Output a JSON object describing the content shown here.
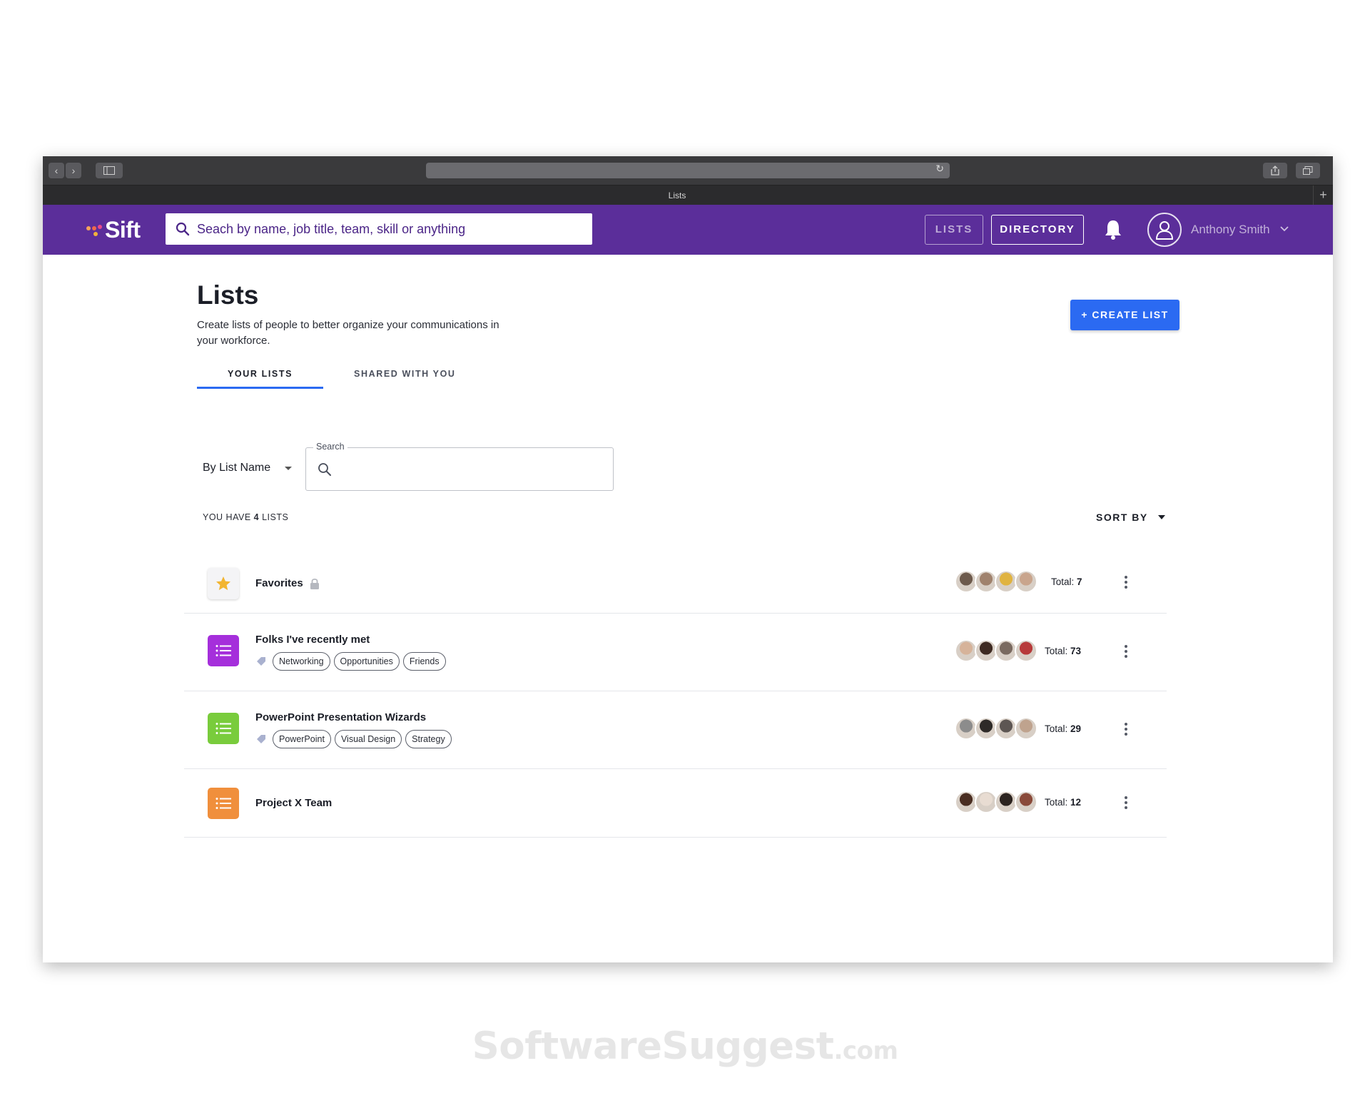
{
  "browser": {
    "tab_title": "Lists",
    "new_tab": "+"
  },
  "header": {
    "logo_text": "Sift",
    "search_placeholder": "Seach by name, job title, team, skill or anything",
    "nav": [
      {
        "label": "LISTS",
        "active": false
      },
      {
        "label": "DIRECTORY",
        "active": true
      }
    ],
    "user_name": "Anthony Smith",
    "brand_color": "#5b2e9a"
  },
  "page": {
    "title": "Lists",
    "subtitle": "Create lists of people to better organize your communications in your workforce.",
    "create_button": "+ CREATE LIST",
    "tabs": [
      {
        "label": "YOUR LISTS",
        "active": true
      },
      {
        "label": "SHARED WITH YOU",
        "active": false
      }
    ],
    "filter_label": "By List Name",
    "search_label": "Search",
    "count_prefix": "YOU HAVE",
    "count_value": "4",
    "count_suffix": "LISTS",
    "sort_label": "SORT BY"
  },
  "lists": [
    {
      "name": "Favorites",
      "icon": "star-icon",
      "color": "#f4f4f6",
      "locked": true,
      "tags": [],
      "total_label": "Total:",
      "total": "7",
      "faces": [
        "#6d5a4c",
        "#a0826d",
        "#e0b341",
        "#c9a58d"
      ]
    },
    {
      "name": "Folks I've recently met",
      "icon": "list-icon",
      "color": "#a52fdb",
      "locked": false,
      "tags": [
        "Networking",
        "Opportunities",
        "Friends"
      ],
      "total_label": "Total:",
      "total": "73",
      "faces": [
        "#d6b39a",
        "#3e2a22",
        "#7a6a60",
        "#b73a3a"
      ]
    },
    {
      "name": "PowerPoint Presentation Wizards",
      "icon": "list-icon",
      "color": "#79cc3c",
      "locked": false,
      "tags": [
        "PowerPoint",
        "Visual Design",
        "Strategy"
      ],
      "total_label": "Total:",
      "total": "29",
      "faces": [
        "#8c8c8c",
        "#2e2a28",
        "#5d5653",
        "#bfa38e"
      ]
    },
    {
      "name": "Project X Team",
      "icon": "list-icon",
      "color": "#f08f3c",
      "locked": false,
      "tags": [],
      "total_label": "Total:",
      "total": "12",
      "faces": [
        "#4a2e22",
        "#e8dcd2",
        "#2c2420",
        "#8a4a3a"
      ]
    }
  ],
  "watermark": {
    "main": "SoftwareSuggest",
    "suffix": ".com"
  },
  "colors": {
    "accent": "#2b6af2",
    "tab_underline": "#2b6af2"
  }
}
